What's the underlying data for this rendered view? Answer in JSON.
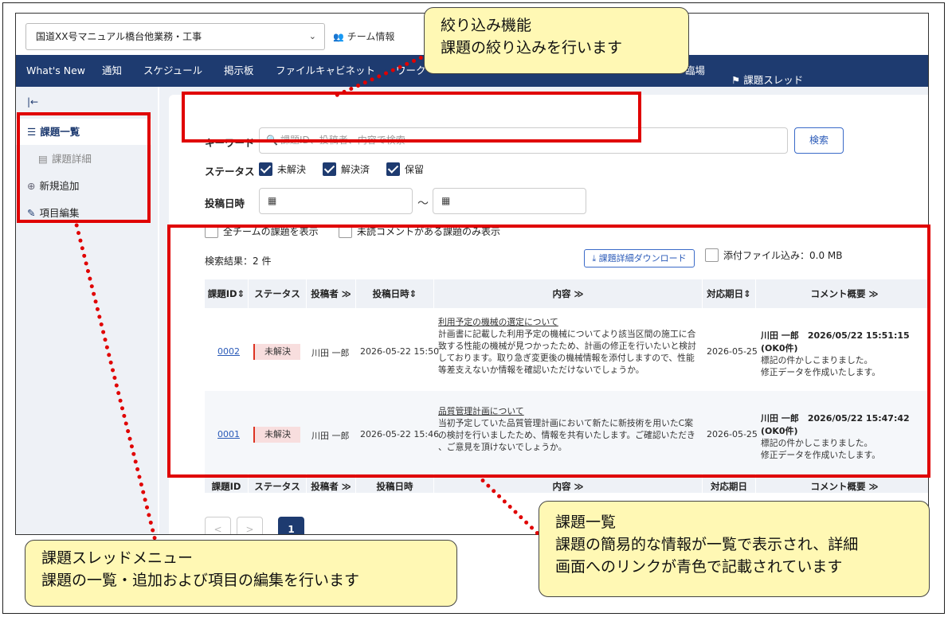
{
  "project_select": {
    "value": "国道XX号マニュアル橋台他業務・工事"
  },
  "team_info": "チーム情報",
  "nav": {
    "items": [
      "What's New",
      "通知",
      "スケジュール",
      "掲示板",
      "ファイルキャビネット",
      "ワーク",
      "臨場"
    ],
    "active": "課題スレッド"
  },
  "sidebar": {
    "collapse_icon": "collapse-left-icon",
    "items": [
      {
        "label": "課題一覧",
        "icon": "list-icon"
      },
      {
        "label": "課題詳細",
        "icon": "document-icon"
      },
      {
        "label": "新規追加",
        "icon": "add-circle-icon"
      },
      {
        "label": "項目編集",
        "icon": "pencil-icon"
      }
    ]
  },
  "filter": {
    "keyword_label": "キーワード",
    "keyword_placeholder": "課題ID、投稿者、内容で検索",
    "search_button": "検索",
    "status_label": "ステータス",
    "statuses": [
      {
        "label": "未解決",
        "checked": true
      },
      {
        "label": "解決済",
        "checked": true
      },
      {
        "label": "保留",
        "checked": true
      }
    ],
    "date_label": "投稿日時",
    "date_from": "",
    "date_to": "",
    "tilde": "～",
    "all_teams": "全チームの課題を表示",
    "unread_only": "未読コメントがある課題のみ表示"
  },
  "results": {
    "count_text": "検索結果：2 件",
    "download_button": "課題詳細ダウンロード",
    "attach_label": "添付ファイル込み：0.0 MB",
    "columns": [
      "課題ID",
      "ステータス",
      "投稿者 ≫",
      "投稿日時",
      "内容 ≫",
      "対応期日",
      "コメント概要 ≫"
    ],
    "rows": [
      {
        "id": "0002",
        "status": "未解決",
        "author": "川田 一郎",
        "posted": "2026-05-22 15:50",
        "title": "利用予定の機械の選定について",
        "lines": [
          "計画書に記載した利用予定の機械についてより該当区間の施工に合",
          "致する性能の機械が見つかったため、計画の修正を行いたいと検討",
          "しております。取り急ぎ変更後の機械情報を添付しますので、性能",
          "等差支えないか情報を確認いただけないでしょうか。"
        ],
        "due": "2026-05-25",
        "comment_head": "川田 一郎　2026/05/22 15:51:15　(OK0件)",
        "comment_lines": [
          "標記の件かしこまりました。",
          "修正データを作成いたします。"
        ]
      },
      {
        "id": "0001",
        "status": "未解決",
        "author": "川田 一郎",
        "posted": "2026-05-22 15:46",
        "title": "品質管理計画について",
        "lines": [
          "当初予定していた品質管理計画において新たに新技術を用いたC案",
          "の検討を行いましたため、情報を共有いたします。ご確認いただき",
          "、ご意見を頂けないでしょうか。"
        ],
        "due": "2026-05-25",
        "comment_head": "川田 一郎　2026/05/22 15:47:42　(OK0件)",
        "comment_lines": [
          "標記の件かしこまりました。",
          "修正データを作成いたします。"
        ]
      }
    ]
  },
  "pagination": {
    "prev": "<",
    "next": ">",
    "current": "1"
  },
  "callouts": {
    "filter": [
      "絞り込み機能",
      "課題の絞り込みを行います"
    ],
    "list": [
      "課題一覧",
      "課題の簡易的な情報が一覧で表示され、詳細",
      "画面へのリンクが青色で記載されています"
    ],
    "menu": [
      "課題スレッドメニュー",
      "課題の一覧・追加および項目の編集を行います"
    ]
  },
  "colors": {
    "nav": "#1e3b70",
    "highlight": "#e00000",
    "callout": "#fff8b4",
    "link": "#2a5ab8"
  }
}
